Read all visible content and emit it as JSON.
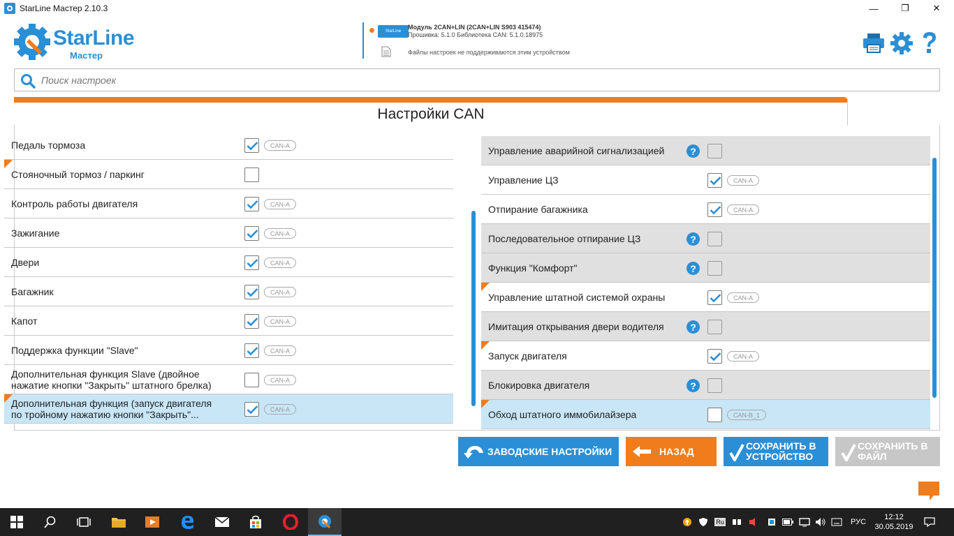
{
  "window": {
    "title": "StarLine Мастер 2.10.3",
    "minimize": "—",
    "maximize": "❐",
    "close": "✕"
  },
  "logo": {
    "name": "StarLine",
    "sub": "Мастер"
  },
  "device": {
    "chip": "StarLine",
    "module": "Модуль 2CAN+LIN (2CAN+LIN S903 415474)",
    "firmware": "Прошивка: 5.1.0    Библиотека CAN: 5.1.0.18975",
    "notice": "Файлы настроек не поддерживаются этим устройством"
  },
  "search": {
    "placeholder": "Поиск настроек",
    "value": ""
  },
  "tab": {
    "title": "Настройки CAN"
  },
  "left_items": [
    {
      "label": "Педаль тормоза",
      "checked": true,
      "tag": "CAN-A",
      "flag": false
    },
    {
      "label": "Стояночный тормоз / паркинг",
      "checked": false,
      "tag": "",
      "flag": true
    },
    {
      "label": "Контроль работы двигателя",
      "checked": true,
      "tag": "CAN-A",
      "flag": false
    },
    {
      "label": "Зажигание",
      "checked": true,
      "tag": "CAN-A",
      "flag": false
    },
    {
      "label": "Двери",
      "checked": true,
      "tag": "CAN-A",
      "flag": false
    },
    {
      "label": "Багажник",
      "checked": true,
      "tag": "CAN-A",
      "flag": false
    },
    {
      "label": "Капот",
      "checked": true,
      "tag": "CAN-A",
      "flag": false
    },
    {
      "label": "Поддержка функции \"Slave\"",
      "checked": true,
      "tag": "CAN-A",
      "flag": false
    },
    {
      "label": "Дополнительная функция Slave (двойное нажатие кнопки \"Закрыть\" штатного брелка)",
      "checked": false,
      "tag": "CAN-A",
      "flag": false
    },
    {
      "label": "Дополнительная функция (запуск двигателя по тройному нажатию кнопки \"Закрыть\"...",
      "checked": true,
      "tag": "CAN-A",
      "flag": true,
      "selected": true
    }
  ],
  "right_items": [
    {
      "label": "Управление аварийной сигнализацией",
      "checked": false,
      "tag": "",
      "help": true,
      "grey": true,
      "flag": false
    },
    {
      "label": "Управление ЦЗ",
      "checked": true,
      "tag": "CAN-A",
      "help": false,
      "grey": false,
      "flag": false
    },
    {
      "label": "Отпирание багажника",
      "checked": true,
      "tag": "CAN-A",
      "help": false,
      "grey": false,
      "flag": false
    },
    {
      "label": "Последовательное отпирание ЦЗ",
      "checked": false,
      "tag": "",
      "help": true,
      "grey": true,
      "flag": false
    },
    {
      "label": "Функция \"Комфорт\"",
      "checked": false,
      "tag": "",
      "help": true,
      "grey": true,
      "flag": false
    },
    {
      "label": "Управление штатной системой охраны",
      "checked": true,
      "tag": "CAN-A",
      "help": false,
      "grey": false,
      "flag": true
    },
    {
      "label": "Имитация открывания двери водителя",
      "checked": false,
      "tag": "",
      "help": true,
      "grey": true,
      "flag": false
    },
    {
      "label": "Запуск двигателя",
      "checked": true,
      "tag": "CAN-A",
      "help": false,
      "grey": false,
      "flag": true
    },
    {
      "label": "Блокировка двигателя",
      "checked": false,
      "tag": "",
      "help": true,
      "grey": true,
      "flag": false
    },
    {
      "label": "Обход штатного иммобилайзера",
      "checked": false,
      "tag": "CAN-B_1",
      "help": false,
      "grey": false,
      "flag": true,
      "selected": true
    }
  ],
  "buttons": {
    "factory": "ЗАВОДСКИЕ НАСТРОЙКИ",
    "back": "НАЗАД",
    "save_device": "СОХРАНИТЬ В УСТРОЙСТВО",
    "save_file": "СОХРАНИТЬ В ФАЙЛ"
  },
  "colors": {
    "accent": "#2a8fd6",
    "orange": "#f07c1c",
    "disabled": "#c7c7c7"
  },
  "taskbar": {
    "lang": "РУС",
    "time": "12:12",
    "date": "30.05.2019",
    "tray_lang_badge": "Ru"
  }
}
